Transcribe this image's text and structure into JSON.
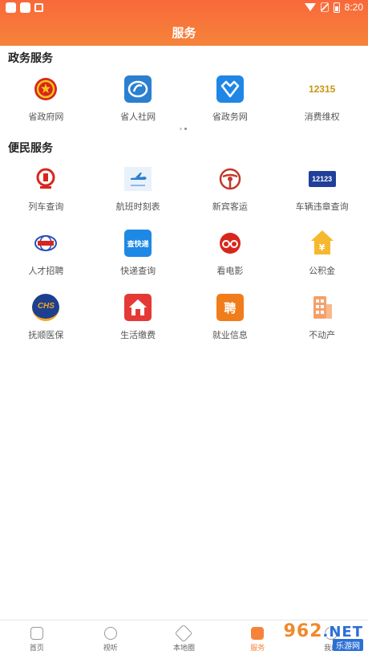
{
  "status": {
    "time": "8:20"
  },
  "header": {
    "title": "服务"
  },
  "gov": {
    "title": "政务服务",
    "items": [
      {
        "label": "省政府网",
        "icon": "national-emblem-icon"
      },
      {
        "label": "省人社网",
        "icon": "si-logo-icon"
      },
      {
        "label": "省政务网",
        "icon": "gov-service-icon"
      },
      {
        "label": "消费维权",
        "icon": "hotline-12315-icon",
        "text": "12315"
      }
    ]
  },
  "people": {
    "title": "便民服务",
    "items": [
      {
        "label": "列车查询",
        "icon": "railway-icon"
      },
      {
        "label": "航班时刻表",
        "icon": "airplane-icon"
      },
      {
        "label": "新宾客运",
        "icon": "bus-icon"
      },
      {
        "label": "车辆违章查询",
        "icon": "traffic-12123-icon",
        "text": "12123"
      },
      {
        "label": "人才招聘",
        "icon": "talent-icon"
      },
      {
        "label": "快递查询",
        "icon": "express-icon",
        "text": "查快递"
      },
      {
        "label": "看电影",
        "icon": "movie-icon"
      },
      {
        "label": "公积金",
        "icon": "fund-icon",
        "text": "¥"
      },
      {
        "label": "抚顺医保",
        "icon": "medical-insurance-icon",
        "text": "CHS"
      },
      {
        "label": "生活缴费",
        "icon": "home-icon"
      },
      {
        "label": "就业信息",
        "icon": "job-icon",
        "text": "聘"
      },
      {
        "label": "不动产",
        "icon": "building-icon"
      }
    ]
  },
  "tabs": [
    {
      "label": "首页",
      "active": false
    },
    {
      "label": "视听",
      "active": false
    },
    {
      "label": "本地圈",
      "active": false
    },
    {
      "label": "服务",
      "active": true
    },
    {
      "label": "我的",
      "active": false
    }
  ],
  "watermark": {
    "top": "962",
    "net": ".NET",
    "bottom": "乐游网"
  },
  "colors": {
    "accent": "#f5843a",
    "header_top": "#f9683a"
  }
}
